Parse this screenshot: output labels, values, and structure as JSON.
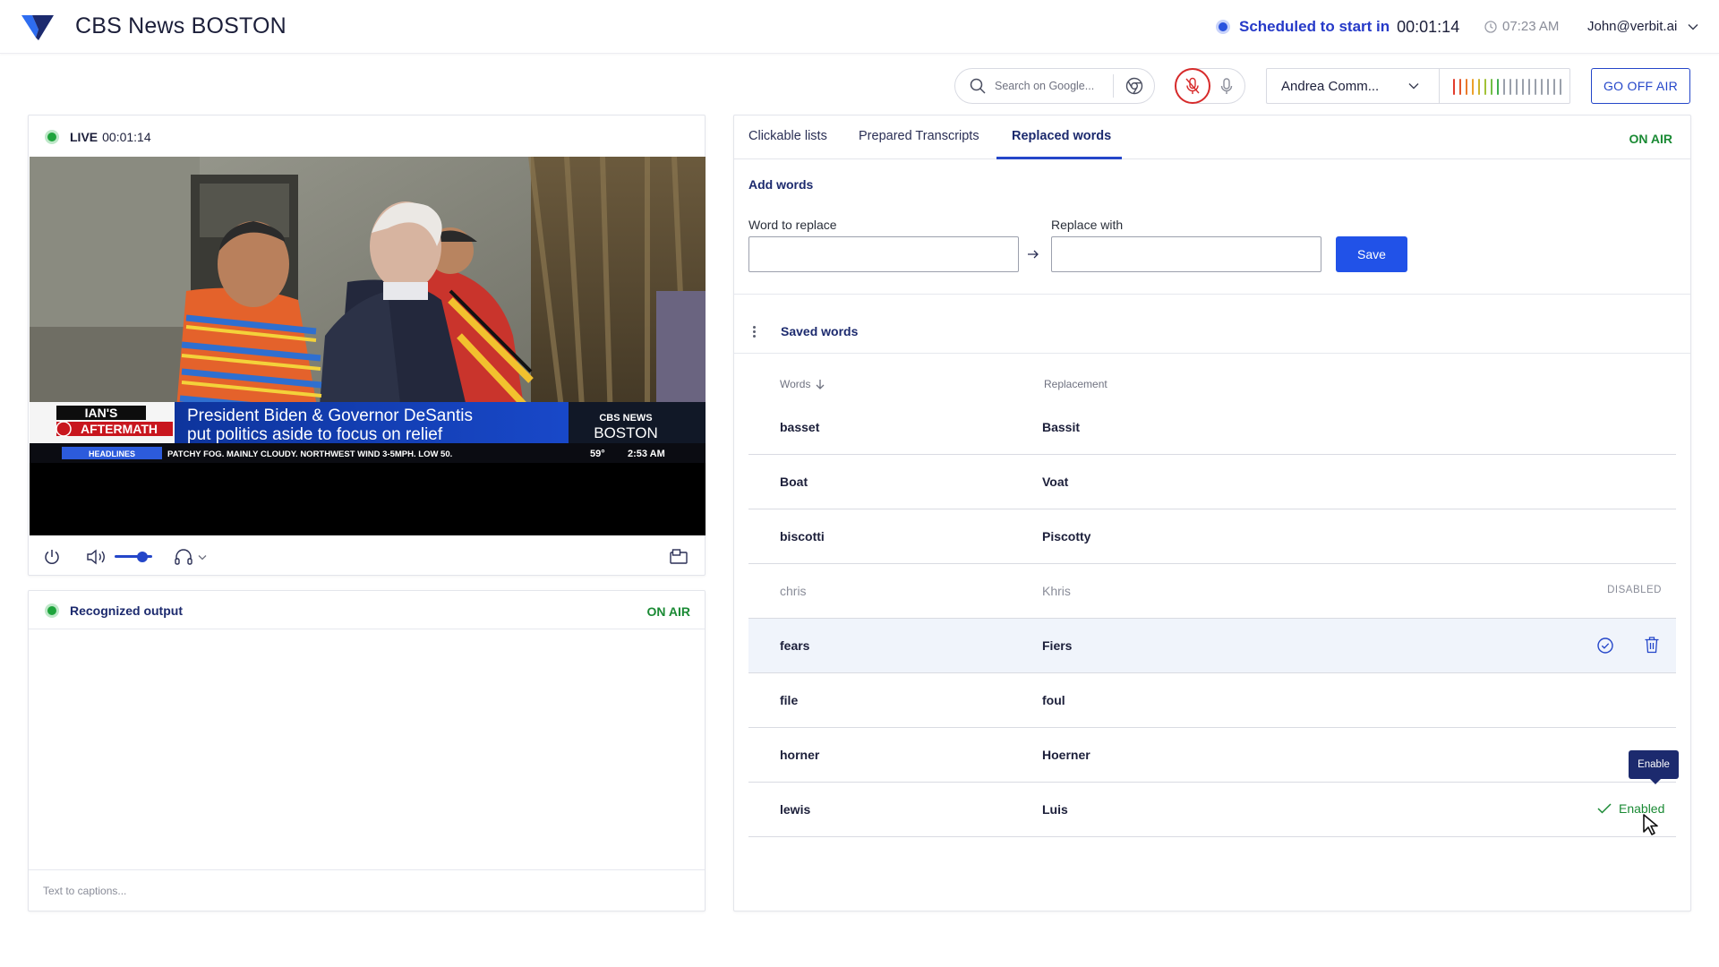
{
  "header": {
    "title": "CBS News BOSTON",
    "schedule_label": "Scheduled to start in",
    "schedule_time": "00:01:14",
    "clock_time": "07:23 AM",
    "user_email": "John@verbit.ai",
    "logo_icon": "verbit-logo-icon"
  },
  "toolbar": {
    "search_placeholder": "Search on Google...",
    "speaker_name": "Andrea Comm...",
    "go_off_air_label": "GO OFF AIR",
    "meter_colors": [
      "#e23c2c",
      "#e3572b",
      "#ea7a29",
      "#eda02a",
      "#cdb52d",
      "#a2c237",
      "#6fbf45",
      "#3fae4e",
      "#9aa0ab",
      "#9aa0ab",
      "#9aa0ab",
      "#9aa0ab",
      "#9aa0ab",
      "#9aa0ab",
      "#9aa0ab",
      "#9aa0ab",
      "#9aa0ab",
      "#9aa0ab"
    ]
  },
  "live": {
    "label": "LIVE",
    "time": "00:01:14",
    "video": {
      "bug_line1": "IAN'S",
      "bug_line2": "AFTERMATH",
      "headline_line1": "President Biden & Governor DeSantis",
      "headline_line2": "put politics aside to focus on relief",
      "brand_line1": "CBS NEWS",
      "brand_line2": "BOSTON",
      "ticker_tag": "HEADLINES",
      "ticker_text": "PATCHY FOG. MAINLY CLOUDY. NORTHWEST WIND 3-5MPH. LOW 50.",
      "temp": "59°",
      "ticker_time": "2:53 AM"
    },
    "volume": 0.55
  },
  "output": {
    "title": "Recognized output",
    "status": "ON AIR",
    "placeholder": "Text to captions..."
  },
  "right": {
    "tabs": [
      {
        "label": "Clickable lists"
      },
      {
        "label": "Prepared Transcripts"
      },
      {
        "label": "Replaced words"
      }
    ],
    "status": "ON AIR",
    "add_title": "Add words",
    "word_label": "Word to replace",
    "replace_label": "Replace with",
    "save_label": "Save",
    "saved_title": "Saved words",
    "col_words": "Words",
    "col_replacement": "Replacement",
    "rows": [
      {
        "word": "basset",
        "replacement": "Bassit"
      },
      {
        "word": "Boat",
        "replacement": "Voat"
      },
      {
        "word": "biscotti",
        "replacement": "Piscotty"
      },
      {
        "word": "chris",
        "replacement": "Khris",
        "status": "DISABLED"
      },
      {
        "word": "fears",
        "replacement": "Fiers"
      },
      {
        "word": "file",
        "replacement": "foul"
      },
      {
        "word": "horner",
        "replacement": "Hoerner"
      },
      {
        "word": "lewis",
        "replacement": "Luis",
        "status": "Enabled"
      }
    ],
    "tooltip": "Enable"
  }
}
